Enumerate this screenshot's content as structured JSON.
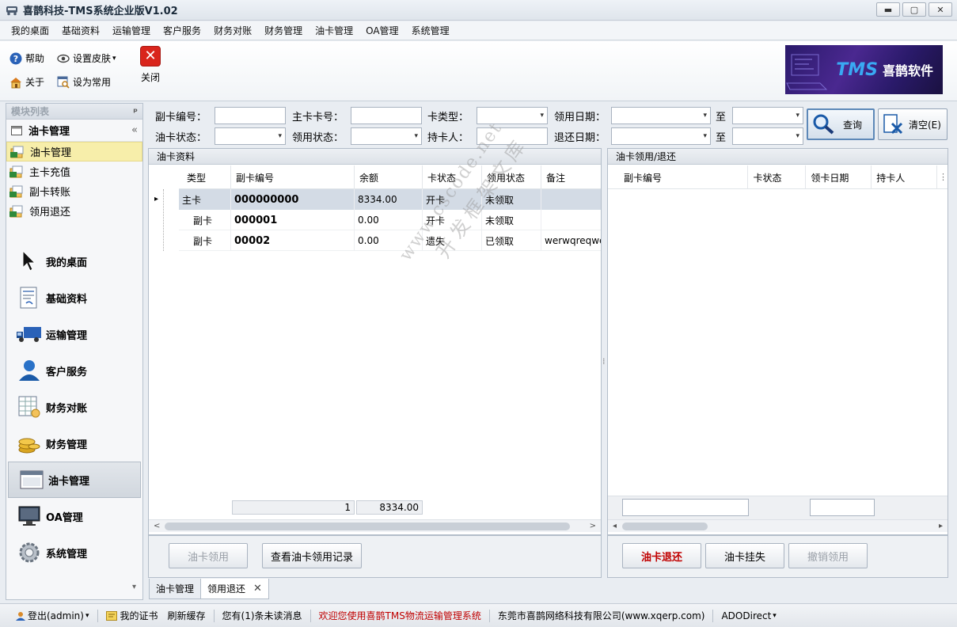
{
  "window": {
    "title": "喜鹊科技-TMS系统企业版V1.02",
    "minimize": "▬",
    "maximize": "▢",
    "close": "✕"
  },
  "menu": [
    "我的桌面",
    "基础资料",
    "运输管理",
    "客户服务",
    "财务对账",
    "财务管理",
    "油卡管理",
    "OA管理",
    "系统管理"
  ],
  "ribbon": {
    "help": "帮助",
    "skin": "设置皮肤",
    "skin_arrow": "▾",
    "about": "关于",
    "favorite": "设为常用",
    "close": "关闭",
    "close_glyph": "✕",
    "logo_tms": "TMS",
    "logo_cn": "喜鹊软件"
  },
  "leftpanel": {
    "header": "模块列表",
    "pin": "ᵖ",
    "group": "油卡管理",
    "collapse": "«",
    "subitems": [
      "油卡管理",
      "主卡充值",
      "副卡转账",
      "领用退还"
    ],
    "navs": [
      "我的桌面",
      "基础资料",
      "运输管理",
      "客户服务",
      "财务对账",
      "财务管理",
      "油卡管理",
      "OA管理",
      "系统管理"
    ],
    "scroll": "▾"
  },
  "filters": {
    "sub_card_no": "副卡编号：",
    "main_card_no": "主卡卡号：",
    "card_type": "卡类型：",
    "receive_date": "领用日期：",
    "to1": "至",
    "oil_status": "油卡状态：",
    "receive_status": "领用状态：",
    "holder": "持卡人：",
    "return_date": "退还日期：",
    "to2": "至",
    "query": "查询",
    "clear": "清空(E)",
    "arrow": "▾"
  },
  "left_grid": {
    "title": "油卡资料",
    "columns": [
      "类型",
      "副卡编号",
      "余额",
      "卡状态",
      "领用状态",
      "备注"
    ],
    "rows": [
      {
        "type": "主卡",
        "no": "000000000",
        "balance": "8334.00",
        "status": "开卡",
        "recv": "未领取",
        "note": ""
      },
      {
        "type": "副卡",
        "no": "000001",
        "balance": "0.00",
        "status": "开卡",
        "recv": "未领取",
        "note": ""
      },
      {
        "type": "副卡",
        "no": "00002",
        "balance": "0.00",
        "status": "遗失",
        "recv": "已领取",
        "note": "werwqreqwe"
      }
    ],
    "footer_count": "1",
    "footer_sum": "8334.00",
    "row_marker": "▸",
    "scroll_left": "<",
    "scroll_right": ">"
  },
  "right_grid": {
    "title": "油卡领用/退还",
    "columns": [
      "副卡编号",
      "卡状态",
      "领卡日期",
      "持卡人"
    ],
    "scroll_left": "◂",
    "scroll_right": "▸",
    "more": "⋮"
  },
  "buttons": {
    "receive": "油卡领用",
    "view_log": "查看油卡领用记录",
    "return": "油卡退还",
    "report_loss": "油卡挂失",
    "cancel_receive": "撤销领用"
  },
  "splitter_grip": "⁞",
  "doc_tabs": [
    {
      "label": "油卡管理"
    },
    {
      "label": "领用退还"
    }
  ],
  "doc_tab_close": "✕",
  "status": {
    "logout": "登出(admin)",
    "certificate": "我的证书",
    "refresh": "刷新缓存",
    "messages": "您有(1)条未读消息",
    "welcome": "欢迎您使用喜鹊TMS物流运输管理系统",
    "company": "东莞市喜鹊网络科技有限公司(www.xqerp.com)",
    "db": "ADODirect",
    "dd": "▾"
  },
  "watermark": {
    "line1": "www.cscode.net",
    "line2": "开发框架文库"
  }
}
